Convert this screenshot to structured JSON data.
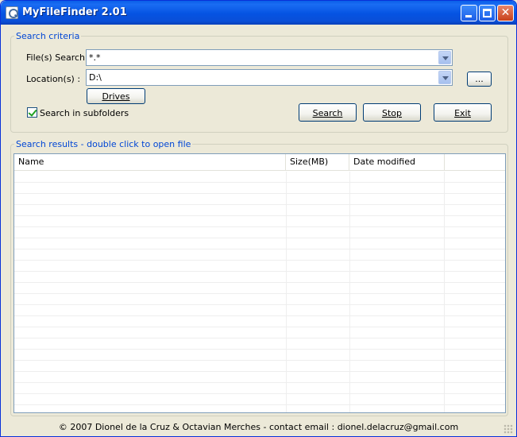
{
  "window": {
    "title": "MyFileFinder 2.01"
  },
  "search_criteria": {
    "group_label": "Search criteria",
    "file_search_label": "File(s) Search:",
    "file_search_value": "*.*",
    "location_label": "Location(s) :",
    "location_value": "D:\\",
    "browse_label": "...",
    "drives_label": "Drives",
    "subfolders_label": "Search in subfolders",
    "subfolders_checked": true,
    "search_label": "Search",
    "stop_label": "Stop",
    "exit_label": "Exit"
  },
  "results": {
    "group_label": "Search results - double click to open file",
    "columns": [
      "Name",
      "Size(MB)",
      "Date modified"
    ]
  },
  "status": {
    "text": "© 2007 Dionel de la Cruz & Octavian Merches - contact email : dionel.delacruz@gmail.com"
  }
}
